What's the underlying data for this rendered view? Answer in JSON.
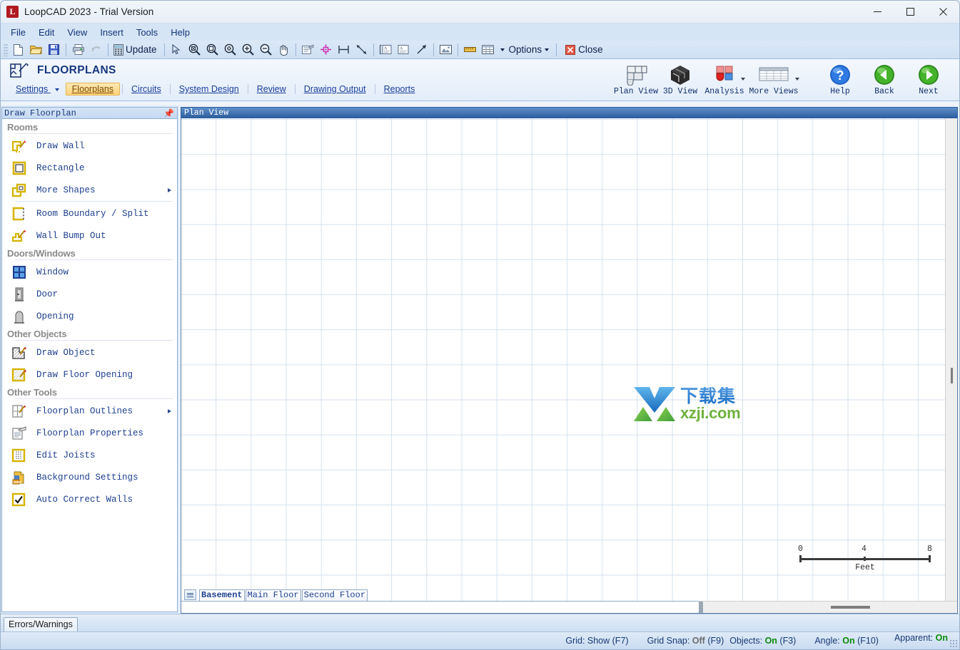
{
  "window": {
    "title": "LoopCAD 2023 - Trial Version",
    "app_badge": "L",
    "minimize": "minimize-button",
    "maximize": "maximize-button",
    "close": "close-button"
  },
  "menu": {
    "items": [
      "File",
      "Edit",
      "View",
      "Insert",
      "Tools",
      "Help"
    ]
  },
  "toolbar": {
    "update_label": "Update",
    "options_label": "Options",
    "close_label": "Close",
    "icons": [
      "new-document-icon",
      "open-folder-icon",
      "save-disk-icon",
      "print-icon",
      "undo-icon",
      "calculator-icon",
      "select-arrow-icon",
      "zoom-extents-icon",
      "zoom-window-icon",
      "zoom-previous-icon",
      "zoom-in-icon",
      "zoom-out-icon",
      "pan-hand-icon",
      "properties-icon",
      "snap-node-icon",
      "dimension-icon",
      "measure-icon",
      "text-box-icon",
      "text-note-icon",
      "leader-arrow-icon",
      "image-icon",
      "ruler-icon",
      "table-icon"
    ]
  },
  "ribbon": {
    "title": "FLOORPLANS",
    "logo": "floorplan-logo-icon",
    "tabs": [
      {
        "label": "Settings",
        "active": false,
        "dropdown": true
      },
      {
        "label": "Floorplans",
        "active": true,
        "dropdown": false
      },
      {
        "label": "Circuits",
        "active": false,
        "dropdown": false
      },
      {
        "label": "System Design",
        "active": false,
        "dropdown": false
      },
      {
        "label": "Review",
        "active": false,
        "dropdown": false
      },
      {
        "label": "Drawing Output",
        "active": false,
        "dropdown": false
      },
      {
        "label": "Reports",
        "active": false,
        "dropdown": false
      }
    ],
    "view_buttons": [
      {
        "label": "Plan View",
        "icon": "plan-view-icon",
        "dropdown": false
      },
      {
        "label": "3D View",
        "icon": "cube-3d-icon",
        "dropdown": false
      },
      {
        "label": "Analysis",
        "icon": "analysis-blocks-icon",
        "dropdown": true
      },
      {
        "label": "More Views",
        "icon": "more-views-table-icon",
        "dropdown": true
      }
    ],
    "nav_buttons": [
      {
        "label": "Help",
        "icon": "help-question-icon"
      },
      {
        "label": "Back",
        "icon": "back-arrow-icon"
      },
      {
        "label": "Next",
        "icon": "next-arrow-icon"
      }
    ]
  },
  "sidebar": {
    "panel_title": "Draw Floorplan",
    "pin_icon": "pin-icon",
    "groups": [
      {
        "label": "Rooms",
        "items": [
          {
            "label": "Draw Wall",
            "icon": "draw-wall-icon",
            "submenu": false
          },
          {
            "label": "Rectangle",
            "icon": "rectangle-icon",
            "submenu": false
          },
          {
            "label": "More Shapes",
            "icon": "more-shapes-icon",
            "submenu": true
          },
          {
            "label": "Room Boundary / Split",
            "icon": "room-boundary-icon",
            "submenu": false
          },
          {
            "label": "Wall Bump Out",
            "icon": "wall-bump-out-icon",
            "submenu": false
          }
        ]
      },
      {
        "label": "Doors/Windows",
        "items": [
          {
            "label": "Window",
            "icon": "window-icon",
            "submenu": false
          },
          {
            "label": "Door",
            "icon": "door-icon",
            "submenu": false
          },
          {
            "label": "Opening",
            "icon": "opening-icon",
            "submenu": false
          }
        ]
      },
      {
        "label": "Other Objects",
        "items": [
          {
            "label": "Draw Object",
            "icon": "draw-object-icon",
            "submenu": false
          },
          {
            "label": "Draw Floor Opening",
            "icon": "draw-floor-opening-icon",
            "submenu": false
          }
        ]
      },
      {
        "label": "Other Tools",
        "items": [
          {
            "label": "Floorplan Outlines",
            "icon": "floorplan-outlines-icon",
            "submenu": true
          },
          {
            "label": "Floorplan Properties",
            "icon": "floorplan-properties-icon",
            "submenu": false
          },
          {
            "label": "Edit Joists",
            "icon": "edit-joists-icon",
            "submenu": false
          },
          {
            "label": "Background Settings",
            "icon": "background-settings-dwg-icon",
            "submenu": false
          },
          {
            "label": "Auto Correct Walls",
            "icon": "auto-correct-walls-icon",
            "submenu": false
          }
        ]
      }
    ]
  },
  "canvas": {
    "header_title": "Plan View",
    "watermark": {
      "cn": "下载集",
      "en": "xzji.com",
      "icon": "xzji-arrow-logo"
    },
    "scale_bar": {
      "ticks": [
        "0",
        "4",
        "8"
      ],
      "unit": "Feet"
    }
  },
  "floor_tabs": {
    "handle_icon": "tab-scroll-handle-icon",
    "tabs": [
      {
        "label": "Basement",
        "active": true
      },
      {
        "label": "Main Floor",
        "active": false
      },
      {
        "label": "Second Floor",
        "active": false
      }
    ]
  },
  "errors_panel": {
    "tab_label": "Errors/Warnings"
  },
  "statusbar": {
    "segments": [
      {
        "name": "grid",
        "label": "Grid: ",
        "value": "Show",
        "value_state": "plain",
        "key": " (F7)"
      },
      {
        "name": "grid-snap",
        "label": "Grid Snap: ",
        "value": "Off",
        "value_state": "off",
        "key": " (F9)"
      },
      {
        "name": "objects",
        "label": "Objects: ",
        "value": "On",
        "value_state": "on",
        "key": " (F3)"
      },
      {
        "name": "angle",
        "label": "Angle: ",
        "value": "On",
        "value_state": "on",
        "key": " (F10)"
      },
      {
        "name": "apparent",
        "label": "Apparent: ",
        "value": "On",
        "value_state": "on",
        "key": ""
      }
    ]
  },
  "colors": {
    "accent_blue": "#16377d",
    "active_tab_bg": "#ffd27a",
    "grid_line": "#d5e2f0",
    "header_gradient_top": "#5f8fc8",
    "header_gradient_bottom": "#2e5f9e",
    "status_on": "#0a8a0a",
    "status_off": "#6b6b6b"
  }
}
